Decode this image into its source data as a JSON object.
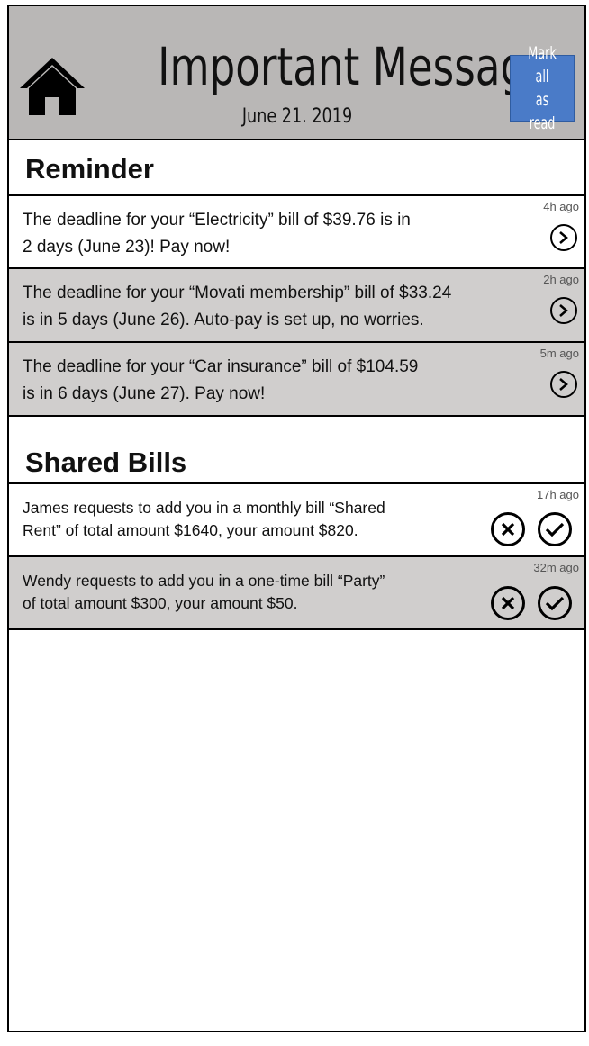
{
  "header": {
    "title": "Important Message",
    "date": "June 21. 2019",
    "mark_all_label_line1": "Mark all",
    "mark_all_label_line2": "as read",
    "home_icon": "home-icon",
    "background_color": "#b9b7b6",
    "button_color": "#4a7bc8"
  },
  "reminder": {
    "heading": "Reminder",
    "items": [
      {
        "line1": "The deadline for your “Electricity” bill of $39.76 is in",
        "line2": "2 days (June 23)! Pay now!",
        "time": "4h ago",
        "action_icon": "chevron-right-circle-icon"
      },
      {
        "line1": "The deadline for your “Movati membership” bill of $33.24",
        "line2": "is in 5 days (June 26). Auto-pay is set up, no worries.",
        "time": "2h ago",
        "action_icon": "chevron-right-circle-icon"
      },
      {
        "line1": "The deadline for your “Car insurance” bill of $104.59",
        "line2": "is in 6 days (June 27). Pay now!",
        "time": "5m ago",
        "action_icon": "chevron-right-circle-icon"
      }
    ]
  },
  "shared": {
    "heading": "Shared Bills",
    "items": [
      {
        "line1": "James requests to add you in a monthly bill “Shared",
        "line2": "Rent” of total amount $1640, your amount $820.",
        "time": "17h ago",
        "reject_icon": "x-circle-icon",
        "accept_icon": "check-circle-icon"
      },
      {
        "line1": "Wendy requests to add you in a one-time bill “Party”",
        "line2": "of total amount $300, your amount $50.",
        "time": "32m ago",
        "reject_icon": "x-circle-icon",
        "accept_icon": "check-circle-icon"
      }
    ]
  }
}
